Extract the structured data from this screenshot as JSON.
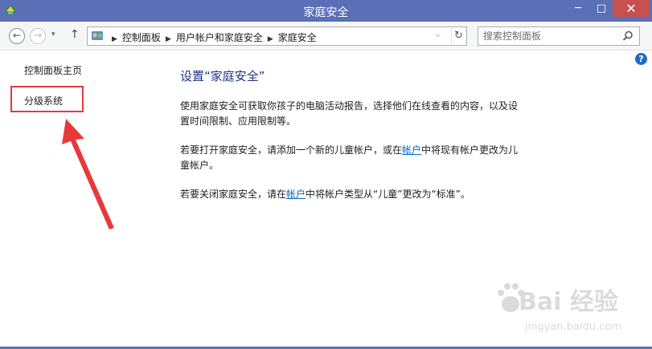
{
  "window": {
    "title": "家庭安全",
    "minimize": "─",
    "maximize": "□",
    "close": "✕"
  },
  "nav": {
    "back": "←",
    "forward": "→",
    "dropdown": "▾",
    "up": "↑"
  },
  "address": {
    "crumbs": [
      "控制面板",
      "用户帐户和家庭安全",
      "家庭安全"
    ],
    "separator": "▶",
    "dropdown": "⌵",
    "refresh": "↻"
  },
  "search": {
    "placeholder": "搜索控制面板"
  },
  "help": "?",
  "sidebar": {
    "home": "控制面板主页",
    "rating": "分级系统"
  },
  "content": {
    "title": "设置“家庭安全”",
    "para1": "使用家庭安全可获取你孩子的电脑活动报告，选择他们在线查看的内容，以及设置时间限制、应用限制等。",
    "para2_before": "若要打开家庭安全，请添加一个新的儿童帐户，或在",
    "para2_link": "帐户",
    "para2_after": "中将现有帐户更改为儿童帐户。",
    "para3_before": "若要关闭家庭安全，请在",
    "para3_link": "帐户",
    "para3_after": "中将帐户类型从“儿童”更改为“标准”。"
  },
  "watermark": {
    "brand": "Bai 经验",
    "url": "jingyan.baidu.com"
  },
  "colors": {
    "titlebar": "#5a6fb5",
    "close": "#c75050",
    "link": "#0066cc",
    "heading": "#1e3287",
    "annotation": "#e8393a"
  }
}
